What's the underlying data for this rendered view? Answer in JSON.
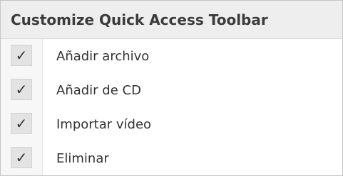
{
  "menu": {
    "title": "Customize Quick Access Toolbar",
    "items": [
      {
        "label": "Añadir archivo",
        "checked": true,
        "check_glyph": "✓"
      },
      {
        "label": "Añadir de CD",
        "checked": true,
        "check_glyph": "✓"
      },
      {
        "label": "Importar vídeo",
        "checked": true,
        "check_glyph": "✓"
      },
      {
        "label": "Eliminar",
        "checked": true,
        "check_glyph": "✓"
      }
    ]
  },
  "colors": {
    "header_bg": "#eeeeee",
    "check_bg": "#e3e3e3",
    "text": "#333333"
  }
}
